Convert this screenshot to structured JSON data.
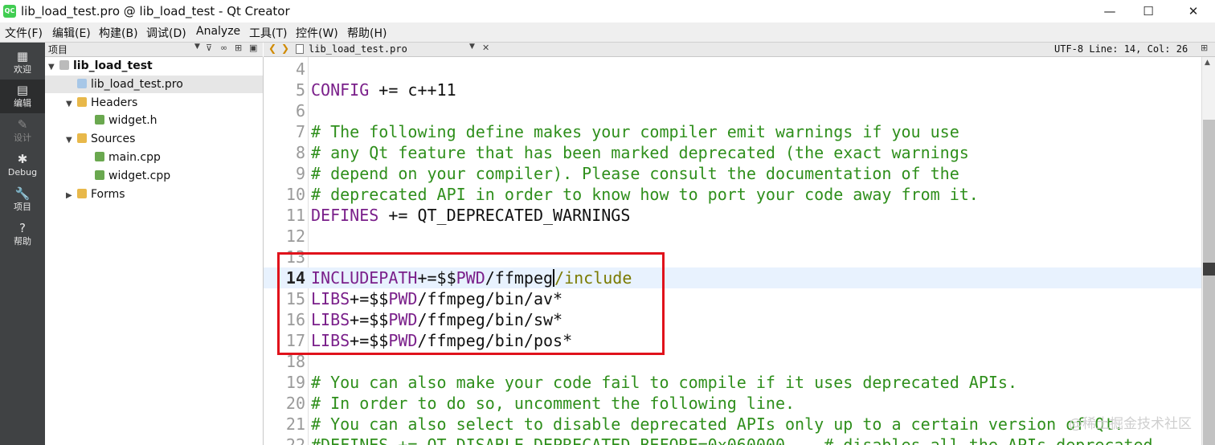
{
  "window": {
    "title": "lib_load_test.pro @ lib_load_test - Qt Creator",
    "app_icon_text": "QC",
    "minimize": "—",
    "maximize": "☐",
    "close": "✕"
  },
  "menubar": [
    {
      "name": "menu-file",
      "label": "文件(F)"
    },
    {
      "name": "menu-edit",
      "label": "编辑(E)"
    },
    {
      "name": "menu-build",
      "label": "构建(B)"
    },
    {
      "name": "menu-debug",
      "label": "调试(D)"
    },
    {
      "name": "menu-analyze",
      "label": "Analyze"
    },
    {
      "name": "menu-tools",
      "label": "工具(T)"
    },
    {
      "name": "menu-widgets",
      "label": "控件(W)"
    },
    {
      "name": "menu-help",
      "label": "帮助(H)"
    }
  ],
  "modebar": [
    {
      "name": "mode-welcome",
      "label": "欢迎",
      "icon": "grid-icon",
      "glyph": "▦",
      "active": false,
      "disabled": false
    },
    {
      "name": "mode-edit",
      "label": "编辑",
      "icon": "document-icon",
      "glyph": "▤",
      "active": true,
      "disabled": false
    },
    {
      "name": "mode-design",
      "label": "设计",
      "icon": "pencil-icon",
      "glyph": "✎",
      "active": false,
      "disabled": true
    },
    {
      "name": "mode-debug",
      "label": "Debug",
      "icon": "bug-icon",
      "glyph": "✱",
      "active": false,
      "disabled": false
    },
    {
      "name": "mode-projects",
      "label": "项目",
      "icon": "wrench-icon",
      "glyph": "🔧",
      "active": false,
      "disabled": false
    },
    {
      "name": "mode-help",
      "label": "帮助",
      "icon": "help-icon",
      "glyph": "?",
      "active": false,
      "disabled": false
    }
  ],
  "project_pane": {
    "title": "项目",
    "tree": [
      {
        "name": "tree-project",
        "label": "lib_load_test",
        "arrow": "▼",
        "icon": "project-icon",
        "bold": true,
        "selected": false
      },
      {
        "name": "tree-pro-file",
        "label": "lib_load_test.pro",
        "arrow": "",
        "icon": "pro-file-icon",
        "bold": false,
        "selected": true
      },
      {
        "name": "tree-headers",
        "label": "Headers",
        "arrow": "▼",
        "icon": "folder-icon",
        "bold": false,
        "selected": false
      },
      {
        "name": "tree-widget-h",
        "label": "widget.h",
        "arrow": "",
        "icon": "header-file-icon",
        "bold": false,
        "selected": false
      },
      {
        "name": "tree-sources",
        "label": "Sources",
        "arrow": "▼",
        "icon": "folder-icon",
        "bold": false,
        "selected": false
      },
      {
        "name": "tree-main-cpp",
        "label": "main.cpp",
        "arrow": "",
        "icon": "cpp-file-icon",
        "bold": false,
        "selected": false
      },
      {
        "name": "tree-widget-cpp",
        "label": "widget.cpp",
        "arrow": "",
        "icon": "cpp-file-icon",
        "bold": false,
        "selected": false
      },
      {
        "name": "tree-forms",
        "label": "Forms",
        "arrow": "▶",
        "icon": "folder-icon",
        "bold": false,
        "selected": false
      }
    ]
  },
  "editor_toolbar": {
    "file_tab": "lib_load_test.pro",
    "status": "UTF-8 Line: 14, Col: 26"
  },
  "editor": {
    "current_line": 14,
    "lines": [
      {
        "num": "4",
        "segments": []
      },
      {
        "num": "5",
        "segments": [
          {
            "t": "CONFIG",
            "c": "kw"
          },
          {
            "t": " += c++11",
            "c": ""
          }
        ]
      },
      {
        "num": "6",
        "segments": []
      },
      {
        "num": "7",
        "segments": [
          {
            "t": "# The following define makes your compiler emit warnings if you use",
            "c": "cm"
          }
        ]
      },
      {
        "num": "8",
        "segments": [
          {
            "t": "# any Qt feature that has been marked deprecated (the exact warnings",
            "c": "cm"
          }
        ]
      },
      {
        "num": "9",
        "segments": [
          {
            "t": "# depend on your compiler). Please consult the documentation of the",
            "c": "cm"
          }
        ]
      },
      {
        "num": "10",
        "segments": [
          {
            "t": "# deprecated API in order to know how to port your code away from it.",
            "c": "cm"
          }
        ]
      },
      {
        "num": "11",
        "segments": [
          {
            "t": "DEFINES",
            "c": "kw"
          },
          {
            "t": " += QT_DEPRECATED_WARNINGS",
            "c": ""
          }
        ]
      },
      {
        "num": "12",
        "segments": []
      },
      {
        "num": "13",
        "segments": []
      },
      {
        "num": "14",
        "segments": [
          {
            "t": "INCLUDEPATH",
            "c": "kw"
          },
          {
            "t": "+=$$",
            "c": ""
          },
          {
            "t": "PWD",
            "c": "kw"
          },
          {
            "t": "/ffmpeg",
            "c": ""
          },
          {
            "t": "|",
            "c": "cursor"
          },
          {
            "t": "/include",
            "c": "ok"
          }
        ]
      },
      {
        "num": "15",
        "segments": [
          {
            "t": "LIBS",
            "c": "kw"
          },
          {
            "t": "+=$$",
            "c": ""
          },
          {
            "t": "PWD",
            "c": "kw"
          },
          {
            "t": "/ffmpeg/bin/av*",
            "c": ""
          }
        ]
      },
      {
        "num": "16",
        "segments": [
          {
            "t": "LIBS",
            "c": "kw"
          },
          {
            "t": "+=$$",
            "c": ""
          },
          {
            "t": "PWD",
            "c": "kw"
          },
          {
            "t": "/ffmpeg/bin/sw*",
            "c": ""
          }
        ]
      },
      {
        "num": "17",
        "segments": [
          {
            "t": "LIBS",
            "c": "kw"
          },
          {
            "t": "+=$$",
            "c": ""
          },
          {
            "t": "PWD",
            "c": "kw"
          },
          {
            "t": "/ffmpeg/bin/pos*",
            "c": ""
          }
        ]
      },
      {
        "num": "18",
        "segments": []
      },
      {
        "num": "19",
        "segments": [
          {
            "t": "# You can also make your code fail to compile if it uses deprecated APIs.",
            "c": "cm"
          }
        ]
      },
      {
        "num": "20",
        "segments": [
          {
            "t": "# In order to do so, uncomment the following line.",
            "c": "cm"
          }
        ]
      },
      {
        "num": "21",
        "segments": [
          {
            "t": "# You can also select to disable deprecated APIs only up to a certain version of Qt.",
            "c": "cm"
          }
        ]
      },
      {
        "num": "22",
        "segments": [
          {
            "t": "#DEFINES += QT_DISABLE_DEPRECATED_BEFORE=0x060000    # disables all the APIs deprecated",
            "c": "cm"
          }
        ]
      }
    ]
  },
  "watermark": "@稀土掘金技术社区"
}
